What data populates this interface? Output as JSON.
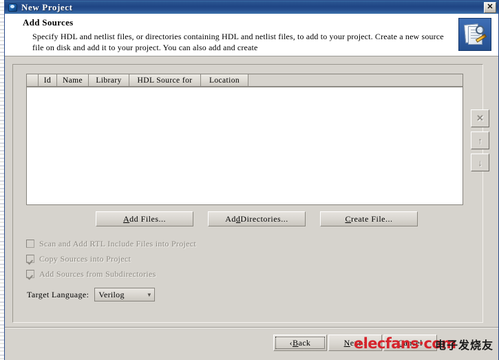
{
  "window": {
    "title": "New Project",
    "icon": "app-globe-icon",
    "close_label": "✕"
  },
  "header": {
    "title": "Add Sources",
    "description": "Specify HDL and netlist files, or directories containing HDL and netlist files, to add to your project. Create a new source file on disk and add it to your project. You can also add and create",
    "icon": "add-sources-icon"
  },
  "source_list": {
    "columns": [
      "Id",
      "Name",
      "Library",
      "HDL Source for",
      "Location"
    ],
    "rows": []
  },
  "side_buttons": [
    {
      "name": "remove-source-button",
      "glyph": "✕",
      "enabled": false
    },
    {
      "name": "move-up-button",
      "glyph": "↑",
      "enabled": false
    },
    {
      "name": "move-down-button",
      "glyph": "↓",
      "enabled": false
    }
  ],
  "action_buttons": [
    {
      "name": "add-files-button",
      "pre": "",
      "mnemonic": "A",
      "post": "dd Files..."
    },
    {
      "name": "add-directories-button",
      "pre": "Ad",
      "mnemonic": "d",
      "post": " Directories..."
    },
    {
      "name": "create-file-button",
      "pre": "",
      "mnemonic": "C",
      "post": "reate File..."
    }
  ],
  "checkboxes": [
    {
      "name": "scan-add-rtl-include-files-checkbox",
      "label": "Scan and Add RTL Include Files into Project",
      "checked": false,
      "enabled": false
    },
    {
      "name": "copy-sources-into-project-checkbox",
      "label": "Copy Sources into Project",
      "checked": true,
      "enabled": false
    },
    {
      "name": "add-sources-from-subdirectories-checkbox",
      "label": "Add Sources from Subdirectories",
      "checked": true,
      "enabled": false
    }
  ],
  "target_language": {
    "label": "Target Language:",
    "value": "Verilog",
    "arrow": "▼"
  },
  "footer": {
    "back": {
      "pre": "‹ ",
      "mnemonic": "B",
      "post": "ack"
    },
    "next": {
      "pre": "",
      "mnemonic": "N",
      "post": "ext ›"
    },
    "cancel": {
      "pre": "",
      "mnemonic": "C",
      "post": "ancel"
    }
  },
  "watermark": {
    "text": "elecfans·com",
    "text_cn": "电子发烧友",
    "color": "#d6232b"
  }
}
